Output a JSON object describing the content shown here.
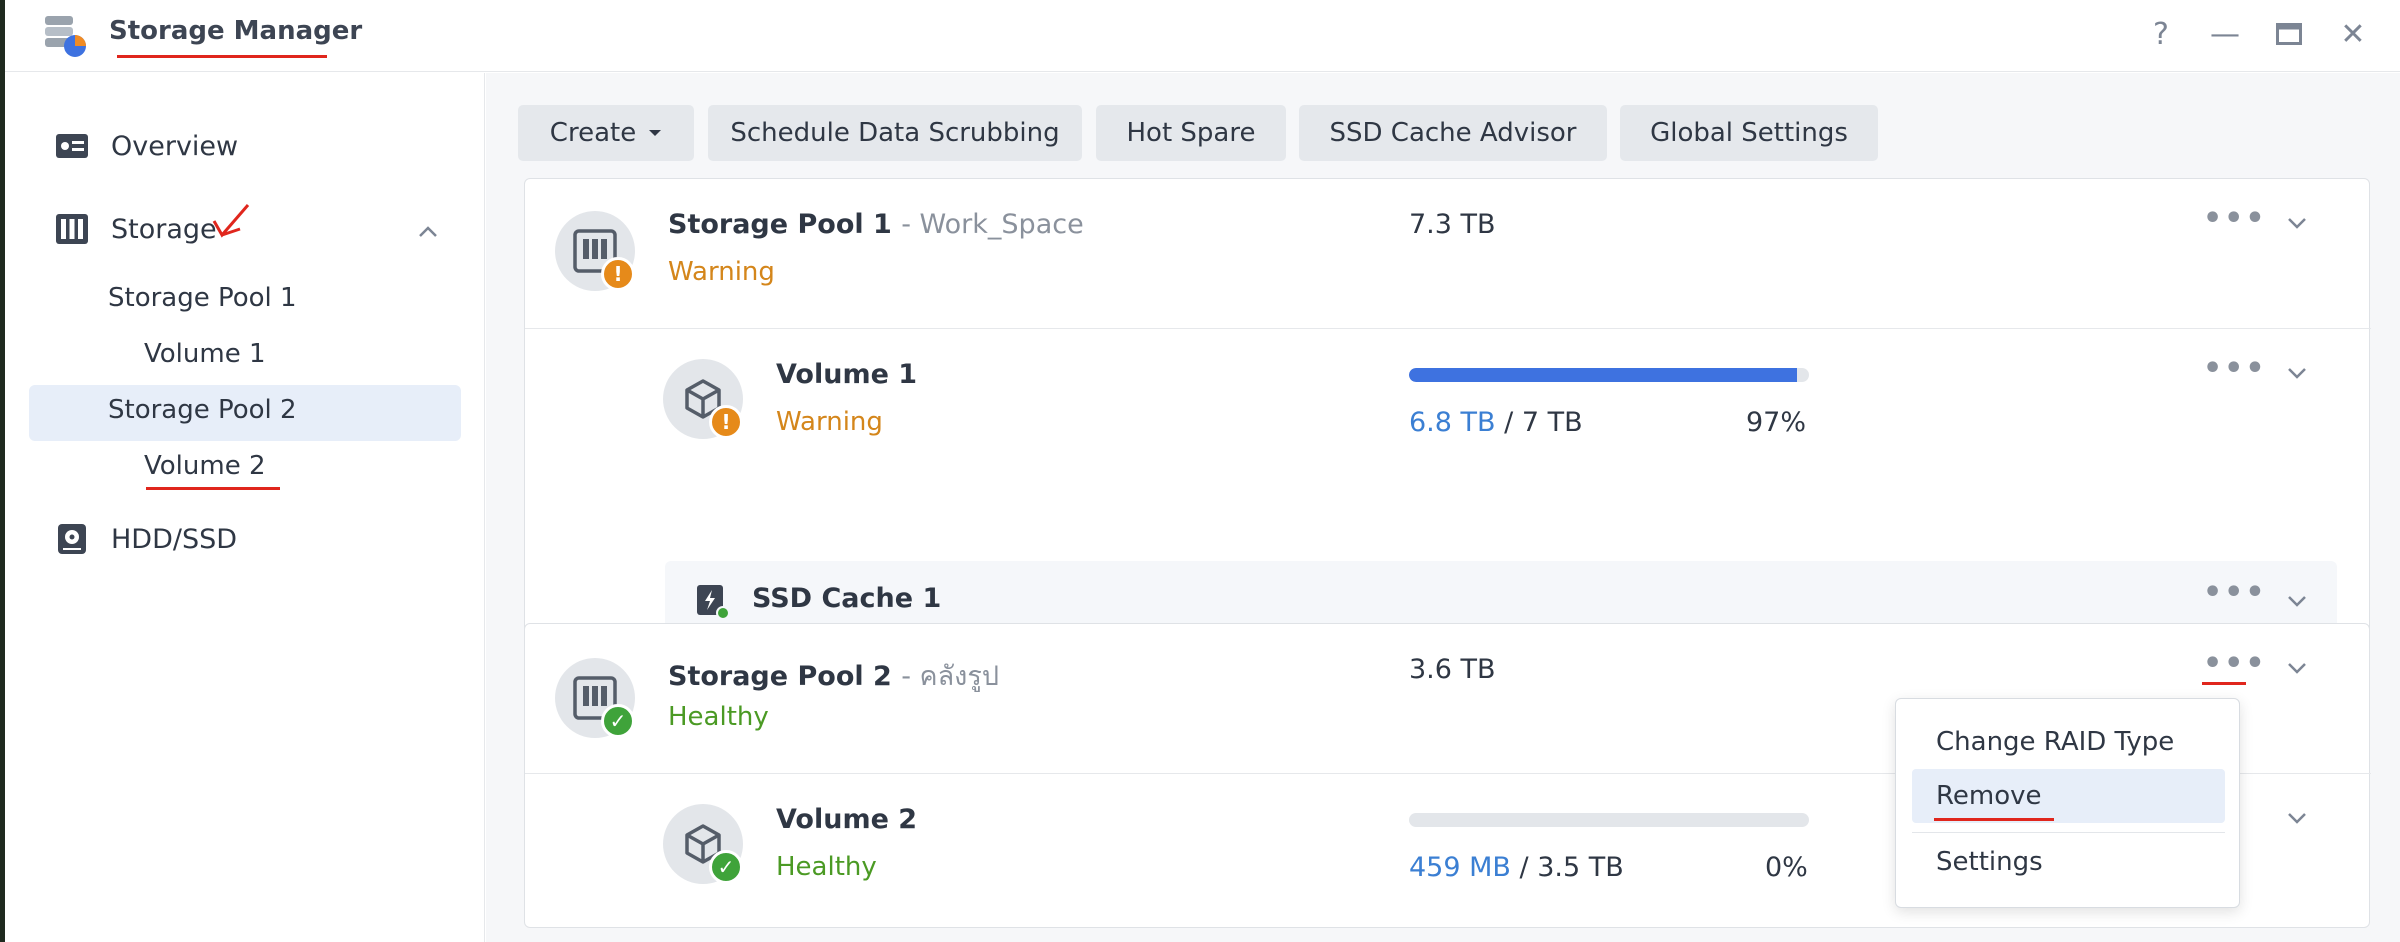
{
  "app": {
    "title": "Storage Manager"
  },
  "window_controls": {
    "help": "?",
    "minimize": "—",
    "maximize": "▭",
    "close": "✕"
  },
  "sidebar": {
    "overview": "Overview",
    "storage": "Storage",
    "storage_children": [
      {
        "label": "Storage Pool 1"
      },
      {
        "label": "Volume 1"
      },
      {
        "label": "Storage Pool 2"
      },
      {
        "label": "Volume 2"
      }
    ],
    "hdd": "HDD/SSD"
  },
  "toolbar": {
    "create": "Create",
    "schedule": "Schedule Data Scrubbing",
    "hot_spare": "Hot Spare",
    "ssd_advisor": "SSD Cache Advisor",
    "global": "Global Settings"
  },
  "pool1": {
    "name": "Storage Pool 1",
    "subtitle": "- Work_Space",
    "status": "Warning",
    "size": "7.3 TB",
    "volume": {
      "name": "Volume 1",
      "status": "Warning",
      "used": "6.8 TB",
      "total": "/ 7 TB",
      "percent": "97%",
      "fill": 0.97
    },
    "cache": {
      "name": "SSD Cache 1"
    }
  },
  "pool2": {
    "name": "Storage Pool 2",
    "subtitle": "- คลังรูป",
    "status": "Healthy",
    "size": "3.6 TB",
    "volume": {
      "name": "Volume 2",
      "status": "Healthy",
      "used": "459 MB",
      "total": "/ 3.5 TB",
      "percent": "0%",
      "fill": 0.0
    }
  },
  "context_menu": {
    "items": [
      {
        "label": "Change RAID Type"
      },
      {
        "label": "Remove"
      },
      {
        "label": "Settings"
      }
    ]
  },
  "colors": {
    "warning": "#d4861b",
    "healthy": "#4b9a24",
    "accent": "#3e72e0",
    "annotation": "#e0261d"
  }
}
